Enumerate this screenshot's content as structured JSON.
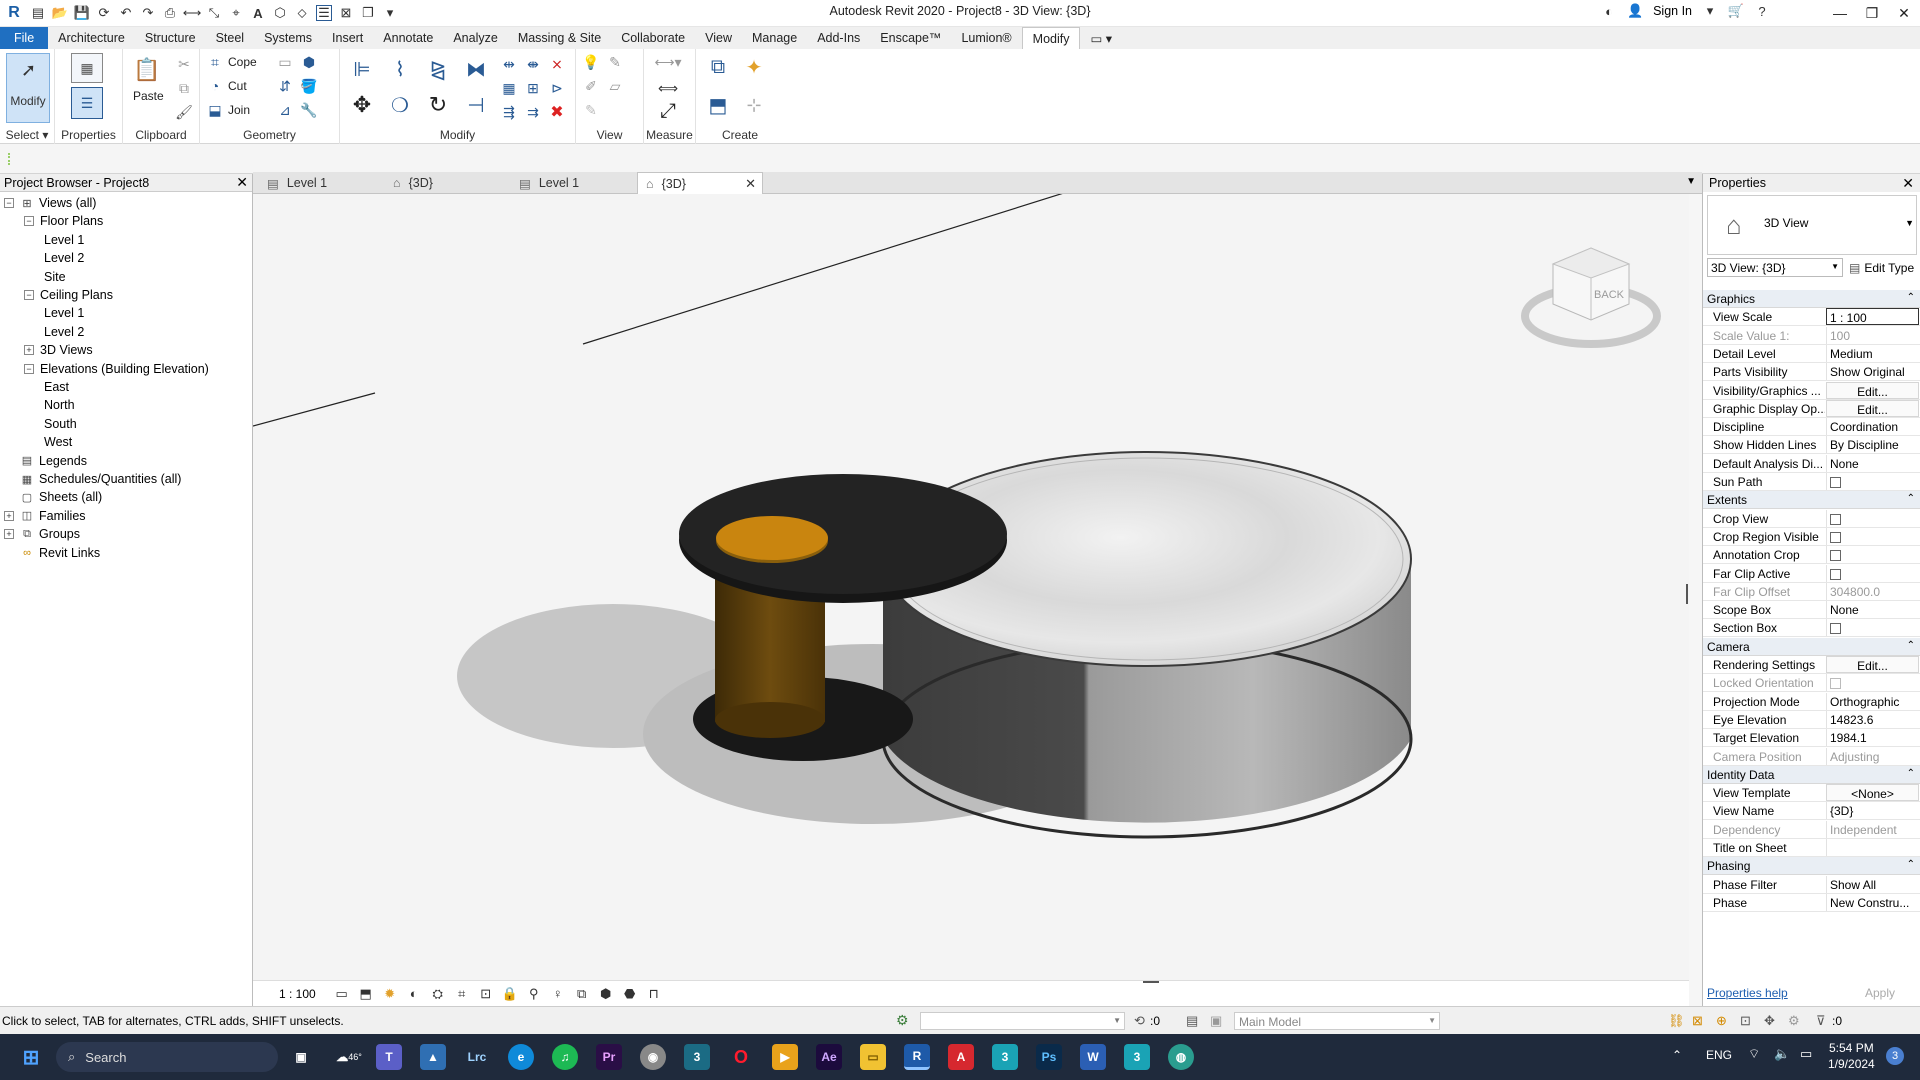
{
  "window": {
    "title": "Autodesk Revit 2020 - Project8 - 3D View: {3D}",
    "sign_in": "Sign In"
  },
  "ribbon_tabs": [
    "File",
    "Architecture",
    "Structure",
    "Steel",
    "Systems",
    "Insert",
    "Annotate",
    "Analyze",
    "Massing & Site",
    "Collaborate",
    "View",
    "Manage",
    "Add-Ins",
    "Enscape™",
    "Lumion®",
    "Modify"
  ],
  "ribbon": {
    "select_panel": "Select",
    "modify_btn": "Modify",
    "properties_panel": "Properties",
    "paste_btn": "Paste",
    "clipboard_panel": "Clipboard",
    "cope": "Cope",
    "cut": "Cut",
    "join": "Join",
    "geometry_panel": "Geometry",
    "modify_panel": "Modify",
    "view_panel": "View",
    "measure_panel": "Measure",
    "create_panel": "Create"
  },
  "project_browser": {
    "title": "Project Browser - Project8",
    "items": [
      {
        "label": "Views (all)",
        "level": 0,
        "toggle": "−",
        "icon": "views-icon"
      },
      {
        "label": "Floor Plans",
        "level": 1,
        "toggle": "−"
      },
      {
        "label": "Level 1",
        "level": 2
      },
      {
        "label": "Level 2",
        "level": 2
      },
      {
        "label": "Site",
        "level": 2
      },
      {
        "label": "Ceiling Plans",
        "level": 1,
        "toggle": "−"
      },
      {
        "label": "Level 1",
        "level": 2
      },
      {
        "label": "Level 2",
        "level": 2
      },
      {
        "label": "3D Views",
        "level": 1,
        "toggle": "+"
      },
      {
        "label": "Elevations (Building Elevation)",
        "level": 1,
        "toggle": "−"
      },
      {
        "label": "East",
        "level": 2
      },
      {
        "label": "North",
        "level": 2
      },
      {
        "label": "South",
        "level": 2
      },
      {
        "label": "West",
        "level": 2
      },
      {
        "label": "Legends",
        "level": 0,
        "icon": "legend-icon"
      },
      {
        "label": "Schedules/Quantities (all)",
        "level": 0,
        "icon": "schedule-icon"
      },
      {
        "label": "Sheets (all)",
        "level": 0,
        "icon": "sheet-icon"
      },
      {
        "label": "Families",
        "level": 0,
        "toggle": "+",
        "icon": "families-icon"
      },
      {
        "label": "Groups",
        "level": 0,
        "toggle": "+",
        "icon": "groups-icon"
      },
      {
        "label": "Revit Links",
        "level": 0,
        "icon": "links-icon"
      }
    ]
  },
  "view_tabs": [
    {
      "label": "Level 1",
      "icon": "floor-plan-icon",
      "active": false
    },
    {
      "label": "{3D}",
      "icon": "3d-view-icon",
      "active": false
    },
    {
      "label": "Level 1",
      "icon": "floor-plan-icon",
      "active": false
    },
    {
      "label": "{3D}",
      "icon": "3d-view-icon",
      "active": true
    }
  ],
  "viewcube": {
    "face": "BACK"
  },
  "view_control_bar": {
    "scale": "1 : 100"
  },
  "properties": {
    "title": "Properties",
    "type_name": "3D View",
    "instance_selector": "3D View: {3D}",
    "edit_type": "Edit Type",
    "sections": [
      {
        "name": "Graphics",
        "rows": [
          {
            "k": "View Scale",
            "v": "1 : 100",
            "field": true
          },
          {
            "k": "Scale Value    1:",
            "v": "100",
            "ro": true
          },
          {
            "k": "Detail Level",
            "v": "Medium"
          },
          {
            "k": "Parts Visibility",
            "v": "Show Original"
          },
          {
            "k": "Visibility/Graphics ...",
            "v": "Edit...",
            "button": true
          },
          {
            "k": "Graphic Display Op...",
            "v": "Edit...",
            "button": true
          },
          {
            "k": "Discipline",
            "v": "Coordination"
          },
          {
            "k": "Show Hidden Lines",
            "v": "By Discipline"
          },
          {
            "k": "Default Analysis Di...",
            "v": "None"
          },
          {
            "k": "Sun Path",
            "checkbox": true
          }
        ]
      },
      {
        "name": "Extents",
        "rows": [
          {
            "k": "Crop View",
            "checkbox": true
          },
          {
            "k": "Crop Region Visible",
            "checkbox": true
          },
          {
            "k": "Annotation Crop",
            "checkbox": true
          },
          {
            "k": "Far Clip Active",
            "checkbox": true
          },
          {
            "k": "Far Clip Offset",
            "v": "304800.0",
            "ro": true
          },
          {
            "k": "Scope Box",
            "v": "None"
          },
          {
            "k": "Section Box",
            "checkbox": true
          }
        ]
      },
      {
        "name": "Camera",
        "rows": [
          {
            "k": "Rendering Settings",
            "v": "Edit...",
            "button": true
          },
          {
            "k": "Locked Orientation",
            "checkbox": true,
            "ro": true
          },
          {
            "k": "Projection Mode",
            "v": "Orthographic"
          },
          {
            "k": "Eye Elevation",
            "v": "14823.6"
          },
          {
            "k": "Target Elevation",
            "v": "1984.1"
          },
          {
            "k": "Camera Position",
            "v": "Adjusting",
            "ro": true
          }
        ]
      },
      {
        "name": "Identity Data",
        "rows": [
          {
            "k": "View Template",
            "v": "<None>",
            "button": true
          },
          {
            "k": "View Name",
            "v": "{3D}"
          },
          {
            "k": "Dependency",
            "v": "Independent",
            "ro": true
          },
          {
            "k": "Title on Sheet",
            "v": ""
          }
        ]
      },
      {
        "name": "Phasing",
        "rows": [
          {
            "k": "Phase Filter",
            "v": "Show All"
          },
          {
            "k": "Phase",
            "v": "New Constru..."
          }
        ]
      }
    ],
    "help_link": "Properties help",
    "apply": "Apply"
  },
  "status": {
    "hint": "Click to select, TAB for alternates, CTRL adds, SHIFT unselects.",
    "zero": ":0",
    "model": "Main Model",
    "filter_count": ":0"
  },
  "taskbar": {
    "search": "Search",
    "weather": "46°",
    "lang": "ENG",
    "time": "5:54 PM",
    "date": "1/9/2024",
    "notifications": "3"
  }
}
